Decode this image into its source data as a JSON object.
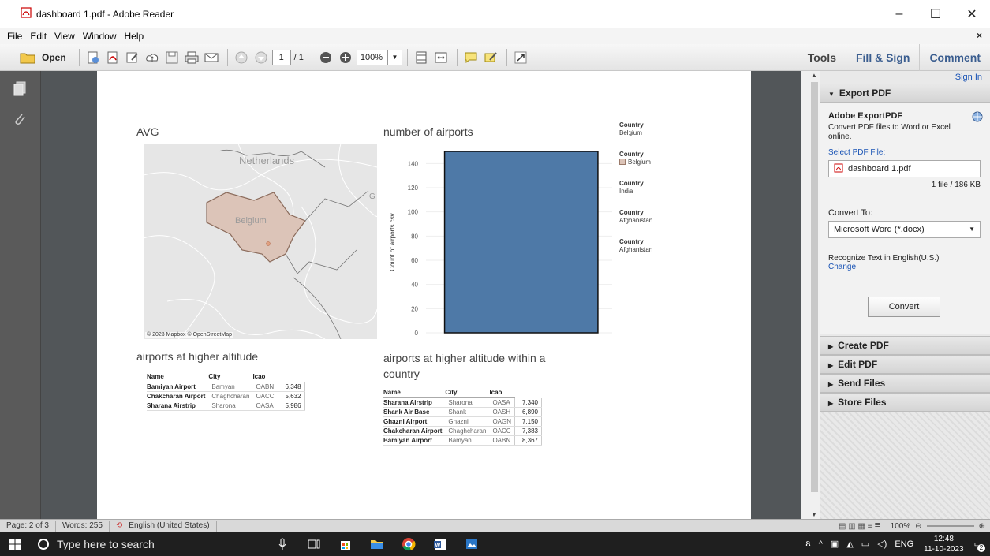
{
  "window": {
    "title": "dashboard 1.pdf - Adobe Reader"
  },
  "menu": [
    "File",
    "Edit",
    "View",
    "Window",
    "Help"
  ],
  "toolbar": {
    "open_label": "Open",
    "page_current": "1",
    "page_total": "/ 1",
    "zoom": "100%",
    "tools": "Tools",
    "fill_sign": "Fill & Sign",
    "comment": "Comment"
  },
  "panel": {
    "sign_in": "Sign In",
    "export_pdf": "Export PDF",
    "adobe_exportpdf": "Adobe ExportPDF",
    "description": "Convert PDF files to Word or Excel online.",
    "select_file": "Select PDF File:",
    "file_name": "dashboard 1.pdf",
    "file_count": "1 file / 186 KB",
    "convert_to": "Convert To:",
    "format": "Microsoft Word (*.docx)",
    "recognize": "Recognize Text in English(U.S.)",
    "change": "Change",
    "convert": "Convert",
    "sections": [
      "Create PDF",
      "Edit PDF",
      "Send Files",
      "Store Files"
    ]
  },
  "status": {
    "page": "Page: 2 of 3",
    "words": "Words: 255",
    "language": "English (United States)",
    "zoom": "100%"
  },
  "taskbar": {
    "search": "Type here to search",
    "lang": "ENG",
    "time": "12:48",
    "date": "11-10-2023",
    "notif": "2"
  },
  "dashboard": {
    "avg_title": "AVG",
    "map_credit": "© 2023 Mapbox © OpenStreetMap",
    "map_labels": {
      "netherlands": "Netherlands",
      "belgium": "Belgium"
    },
    "bar_title": "number of airports",
    "legend": [
      {
        "header": "Country",
        "value": "Belgium",
        "swatch": false
      },
      {
        "header": "Country",
        "value": "Belgium",
        "swatch": true
      },
      {
        "header": "Country",
        "value": "India",
        "swatch": false
      },
      {
        "header": "Country",
        "value": "Afghanistan",
        "swatch": false
      },
      {
        "header": "Country",
        "value": "Afghanistan",
        "swatch": false
      }
    ],
    "table1_title": "airports at higher altitude",
    "table2_title_line1": "airports at higher altitude within a",
    "table2_title_line2": "country",
    "table_headers": [
      "Name",
      "City",
      "Icao"
    ],
    "table1_rows": [
      [
        "Bamiyan Airport",
        "Bamyan",
        "OABN",
        "6,348"
      ],
      [
        "Chakcharan Airport",
        "Chaghcharan",
        "OACC",
        "5,632"
      ],
      [
        "Sharana Airstrip",
        "Sharona",
        "OASA",
        "5,986"
      ]
    ],
    "table2_rows": [
      [
        "Sharana Airstrip",
        "Sharona",
        "OASA",
        "7,340"
      ],
      [
        "Shank Air Base",
        "Shank",
        "OASH",
        "6,890"
      ],
      [
        "Ghazni Airport",
        "Ghazni",
        "OAGN",
        "7,150"
      ],
      [
        "Chakcharan Airport",
        "Chaghcharan",
        "OACC",
        "7,383"
      ],
      [
        "Bamiyan Airport",
        "Bamyan",
        "OABN",
        "8,367"
      ]
    ]
  },
  "chart_data": {
    "type": "bar",
    "title": "number of airports",
    "xlabel": "",
    "ylabel": "Count of airports.csv",
    "categories": [
      ""
    ],
    "values": [
      150
    ],
    "ylim": [
      0,
      150
    ],
    "yticks": [
      0,
      20,
      40,
      60,
      80,
      100,
      120,
      140
    ],
    "bar_color": "#4e79a7"
  },
  "colors": {
    "accent": "#3a5d8f",
    "belgium_fill": "#dcc4b8",
    "bar": "#4e79a7"
  }
}
